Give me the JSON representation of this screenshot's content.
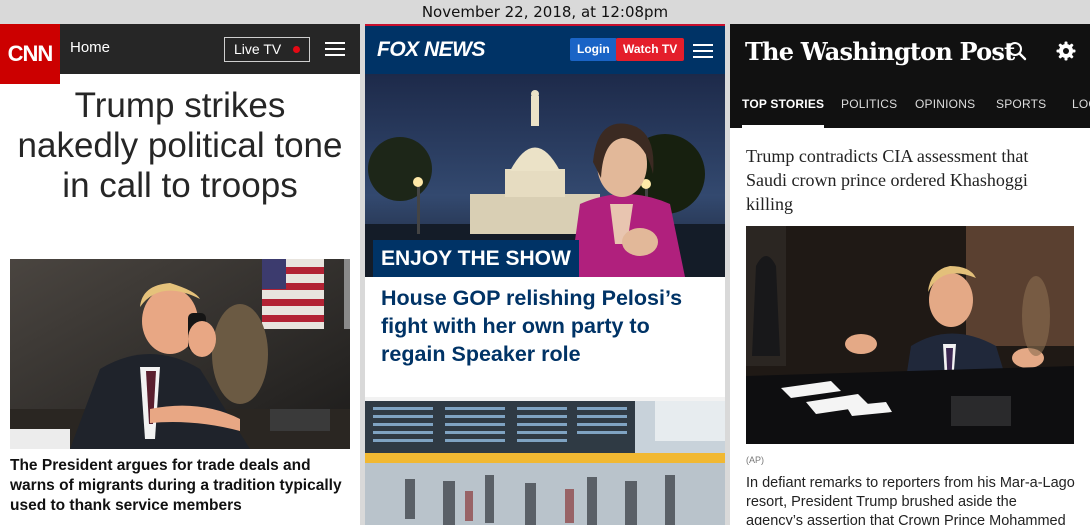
{
  "caption": "November 22, 2018, at 12:08pm",
  "cnn": {
    "logo_text": "CNN",
    "nav_home": "Home",
    "live_tv": "Live TV",
    "headline": "Trump strikes nakedly political tone in call to troops",
    "summary": "The President argues for trade deals and warns of migrants during a tradition typically used to thank service members",
    "colors": {
      "brand": "#cc0000",
      "header": "#262626"
    },
    "icons": [
      "menu-icon",
      "live-dot-icon"
    ]
  },
  "fox": {
    "logo_text": "FOX NEWS",
    "login": "Login",
    "watch_tv": "Watch TV",
    "ribbon": "ENJOY THE SHOW",
    "headline": "House GOP relishing Pelosi’s fight with her own party to regain Speaker role",
    "colors": {
      "brand": "#003366",
      "accent": "#e41e2b",
      "login": "#1a64c6"
    },
    "icons": [
      "menu-icon"
    ]
  },
  "wapo": {
    "logo_text": "The Washington Post",
    "tabs": [
      {
        "label": "TOP STORIES",
        "active": true
      },
      {
        "label": "POLITICS",
        "active": false
      },
      {
        "label": "OPINIONS",
        "active": false
      },
      {
        "label": "SPORTS",
        "active": false
      },
      {
        "label": "LOC",
        "active": false
      }
    ],
    "headline": "Trump contradicts CIA assessment that Saudi crown prince ordered Khashoggi killing",
    "photo_credit": "(AP)",
    "blurb": "In defiant remarks to reporters from his Mar-a-Lago resort, President Trump brushed aside the agency’s assertion that Crown Prince Mohammed bin",
    "icons": [
      "search-icon",
      "gear-icon"
    ]
  }
}
